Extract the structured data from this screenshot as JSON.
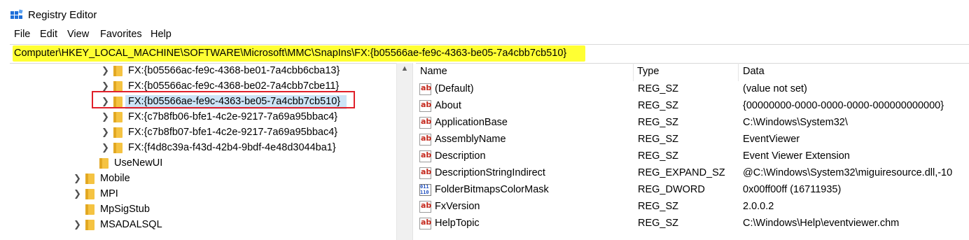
{
  "window": {
    "title": "Registry Editor"
  },
  "menu": [
    "File",
    "Edit",
    "View",
    "Favorites",
    "Help"
  ],
  "address": {
    "path": "Computer\\HKEY_LOCAL_MACHINE\\SOFTWARE\\Microsoft\\MMC\\SnapIns\\FX:{b05566ae-fe9c-4363-be05-7a4cbb7cb510}"
  },
  "tree": {
    "items": [
      {
        "label": "FX:{b05566ac-fe9c-4368-be01-7a4cbb6cba13}",
        "expandable": true
      },
      {
        "label": "FX:{b05566ac-fe9c-4368-be02-7a4cbb7cbe11}",
        "expandable": true
      },
      {
        "label": "FX:{b05566ae-fe9c-4363-be05-7a4cbb7cb510}",
        "expandable": true,
        "selected": true
      },
      {
        "label": "FX:{c7b8fb06-bfe1-4c2e-9217-7a69a95bbac4}",
        "expandable": true
      },
      {
        "label": "FX:{c7b8fb07-bfe1-4c2e-9217-7a69a95bbac4}",
        "expandable": true
      },
      {
        "label": "FX:{f4d8c39a-f43d-42b4-9bdf-4e48d3044ba1}",
        "expandable": true
      },
      {
        "label": "UseNewUI",
        "expandable": false
      },
      {
        "label": "Mobile",
        "expandable": true
      },
      {
        "label": "MPI",
        "expandable": true
      },
      {
        "label": "MpSigStub",
        "expandable": false
      },
      {
        "label": "MSADALSQL",
        "expandable": true
      }
    ]
  },
  "values": {
    "headers": {
      "name": "Name",
      "type": "Type",
      "data": "Data"
    },
    "rows": [
      {
        "name": "(Default)",
        "type": "REG_SZ",
        "data": "(value not set)",
        "icon": "string-value-icon"
      },
      {
        "name": "About",
        "type": "REG_SZ",
        "data": "{00000000-0000-0000-0000-000000000000}",
        "icon": "string-value-icon"
      },
      {
        "name": "ApplicationBase",
        "type": "REG_SZ",
        "data": "C:\\Windows\\System32\\",
        "icon": "string-value-icon"
      },
      {
        "name": "AssemblyName",
        "type": "REG_SZ",
        "data": "EventViewer",
        "icon": "string-value-icon"
      },
      {
        "name": "Description",
        "type": "REG_SZ",
        "data": "Event Viewer Extension",
        "icon": "string-value-icon"
      },
      {
        "name": "DescriptionStringIndirect",
        "type": "REG_EXPAND_SZ",
        "data": "@C:\\Windows\\System32\\miguiresource.dll,-10",
        "icon": "string-value-icon"
      },
      {
        "name": "FolderBitmapsColorMask",
        "type": "REG_DWORD",
        "data": "0x00ff00ff (16711935)",
        "icon": "binary-value-icon"
      },
      {
        "name": "FxVersion",
        "type": "REG_SZ",
        "data": "2.0.0.2",
        "icon": "string-value-icon"
      },
      {
        "name": "HelpTopic",
        "type": "REG_SZ",
        "data": "C:\\Windows\\Help\\eventviewer.chm",
        "icon": "string-value-icon"
      }
    ]
  },
  "icons": {
    "string_glyph": "ab",
    "binary_glyph": "011\n110"
  },
  "colors": {
    "address_highlight": "#ffff33",
    "selection_outline": "#e0202a",
    "selection_fill": "#cce4f7",
    "folder": "#f5c342"
  }
}
